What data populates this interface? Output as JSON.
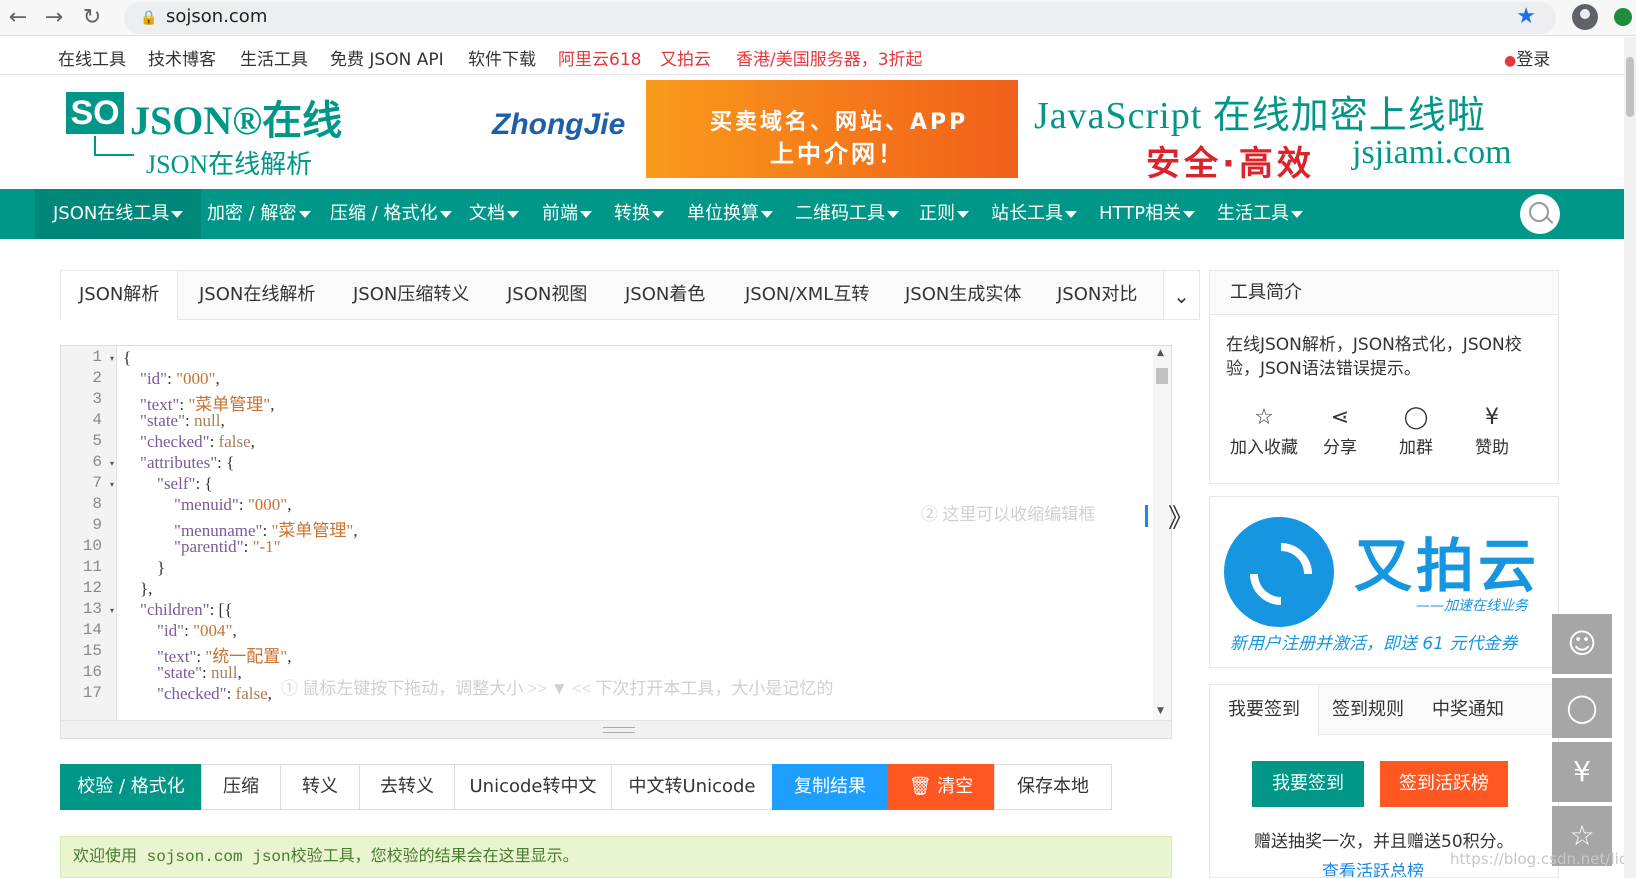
{
  "browser": {
    "url": "sojson.com",
    "back_icon": "←",
    "forward_icon": "→",
    "reload_icon": "↻"
  },
  "toplinks": {
    "items": [
      "在线工具",
      "技术博客",
      "生活工具",
      "免费 JSON API",
      "软件下载",
      "阿里云618",
      "又拍云",
      "香港/美国服务器，3折起"
    ],
    "login": "登录"
  },
  "header": {
    "logo_so": "SO",
    "logo_main": "JSON®在线",
    "logo_sub": "JSON在线解析",
    "ad_zhongjie": {
      "logo": "ZhongJie",
      "line1": "买卖域名、网站、APP",
      "line2": "上中介网！"
    },
    "ad_jsjiami": {
      "line1": "JavaScript 在线加密上线啦",
      "line2a": "安全·高效",
      "line2b": "jsjiami.com"
    }
  },
  "mainnav": {
    "items": [
      "JSON在线工具",
      "加密 / 解密",
      "压缩 / 格式化",
      "文档",
      "前端",
      "转换",
      "单位换算",
      "二维码工具",
      "正则",
      "站长工具",
      "HTTP相关",
      "生活工具"
    ]
  },
  "tabs": {
    "items": [
      "JSON解析",
      "JSON在线解析",
      "JSON压缩转义",
      "JSON视图",
      "JSON着色",
      "JSON/XML互转",
      "JSON生成实体",
      "JSON对比"
    ],
    "more_icon": "⌄"
  },
  "editor": {
    "line_numbers": [
      "1",
      "2",
      "3",
      "4",
      "5",
      "6",
      "7",
      "8",
      "9",
      "10",
      "11",
      "12",
      "13",
      "14",
      "15",
      "16",
      "17"
    ],
    "lines": [
      "{",
      "    \"id\": \"000\",",
      "    \"text\": \"菜单管理\",",
      "    \"state\": null,",
      "    \"checked\": false,",
      "    \"attributes\": {",
      "        \"self\": {",
      "            \"menuid\": \"000\",",
      "            \"menuname\": \"菜单管理\",",
      "            \"parentid\": \"-1\"",
      "        }",
      "    },",
      "    \"children\": [{",
      "        \"id\": \"004\",",
      "        \"text\": \"统一配置\",",
      "        \"state\": null,",
      "        \"checked\": false,"
    ],
    "hint_collapse": "② 这里可以收缩编辑框",
    "hint_resize": "① 鼠标左键按下拖动，调整大小 >> ▼ << 下次打开本工具，大小是记忆的",
    "collapse_icon": "》"
  },
  "actions": {
    "validate": "校验 / 格式化",
    "compress": "压缩",
    "escape": "转义",
    "unescape": "去转义",
    "unicode_to_cn": "Unicode转中文",
    "cn_to_unicode": "中文转Unicode",
    "copy": "复制结果",
    "clear": "🗑 清空",
    "save": "保存本地"
  },
  "result": {
    "message": "欢迎使用 sojson.com json校验工具，您校验的结果会在这里显示。"
  },
  "sidebar": {
    "intro_title": "工具简介",
    "intro_text": "在线JSON解析，JSON格式化，JSON校验，JSON语法错误提示。",
    "actions": [
      {
        "icon": "☆",
        "label": "加入收藏"
      },
      {
        "icon": "⋖",
        "label": "分享"
      },
      {
        "icon": "◯",
        "label": "加群"
      },
      {
        "icon": "¥",
        "label": "赞助"
      }
    ],
    "upyun": {
      "name": "又拍云",
      "tagline": "——加速在线业务",
      "promo": "新用户注册并激活，即送 61 元代金券"
    },
    "sign": {
      "tabs": [
        "我要签到",
        "签到规则",
        "中奖通知"
      ],
      "sign_button": "我要签到",
      "ranking_button": "签到活跃榜",
      "text": "赠送抽奖一次，并且赠送50积分。",
      "link": "查看活跃总榜"
    }
  },
  "float": {
    "icons": [
      "☺",
      "◯",
      "¥",
      "☆"
    ]
  },
  "watermark": "https://blog.csdn.net/licmi",
  "colors": {
    "brand": "#009688",
    "blue": "#1e9fff",
    "orange": "#ff5722"
  }
}
